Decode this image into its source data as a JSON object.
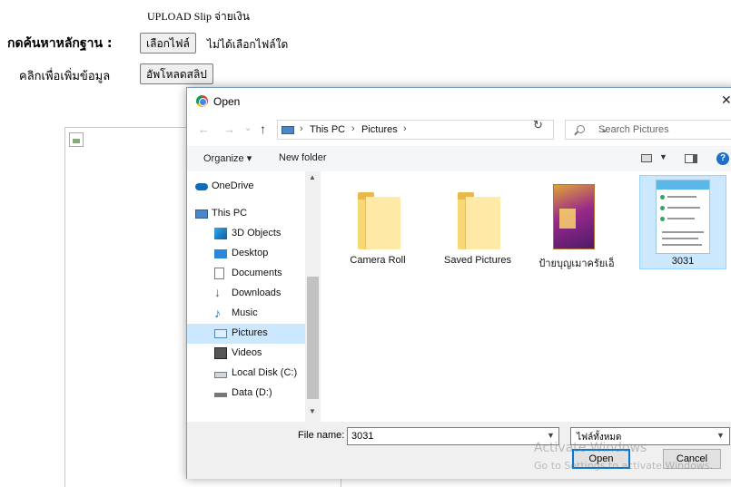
{
  "page": {
    "title": "UPLOAD Slip จ่ายเงิน",
    "search_proof_label": "กดค้นหาหลักฐาน :",
    "choose_file_label": "เลือกไฟล์",
    "no_file_text": "ไม่ได้เลือกไฟล์ใด",
    "click_to_add_label": "คลิกเพื่อเพิ่มข้อมูล",
    "upload_slip_label": "อัพโหลดสลิป"
  },
  "dialog": {
    "title": "Open",
    "close_glyph": "✕",
    "nav": {
      "back": "←",
      "forward": "→",
      "dropdown": "⌄",
      "up": "↑",
      "refresh": "↻"
    },
    "breadcrumb": [
      "This PC",
      "Pictures"
    ],
    "breadcrumb_sep": "›",
    "search_placeholder": "Search Pictures",
    "toolbar": {
      "organize": "Organize ▾",
      "new_folder": "New folder",
      "help": "?"
    },
    "nav_items": [
      {
        "label": "OneDrive",
        "icon": "onedrive-icon"
      },
      {
        "label": "This PC",
        "icon": "computer-icon"
      },
      {
        "label": "3D Objects",
        "icon": "3d-objects-icon"
      },
      {
        "label": "Desktop",
        "icon": "desktop-icon"
      },
      {
        "label": "Documents",
        "icon": "documents-icon"
      },
      {
        "label": "Downloads",
        "icon": "downloads-icon"
      },
      {
        "label": "Music",
        "icon": "music-icon"
      },
      {
        "label": "Pictures",
        "icon": "pictures-icon",
        "selected": true
      },
      {
        "label": "Videos",
        "icon": "videos-icon"
      },
      {
        "label": "Local Disk (C:)",
        "icon": "local-disk-icon"
      },
      {
        "label": "Data (D:)",
        "icon": "drive-icon"
      }
    ],
    "files": [
      {
        "name": "Camera Roll",
        "kind": "folder"
      },
      {
        "name": "Saved Pictures",
        "kind": "folder"
      },
      {
        "name": "ป้ายบุญเมาครัยเอ็",
        "kind": "image"
      },
      {
        "name": "3031",
        "kind": "image",
        "selected": true
      }
    ],
    "file_name_label": "File name:",
    "file_name_value": "3031",
    "file_type_value": "ไฟล์ทั้งหมด",
    "open_label": "Open",
    "cancel_label": "Cancel",
    "colors": {
      "selection": "#cce8ff",
      "accent": "#0078d7"
    }
  },
  "watermark": {
    "line1": "Activate Windows",
    "line2": "Go to Settings to activate Windows."
  }
}
